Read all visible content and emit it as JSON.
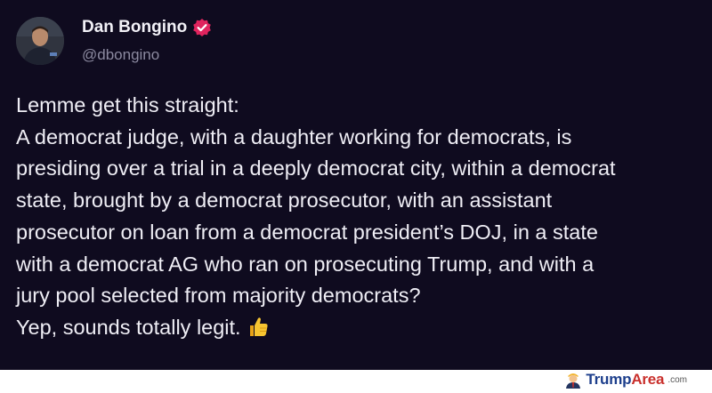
{
  "post": {
    "author_name": "Dan Bongino",
    "author_handle": "@dbongino",
    "body_lines": [
      "Lemme get this straight:",
      "A democrat judge, with a daughter working for democrats, is",
      "presiding over a trial in a deeply democrat city, within a democrat",
      "state, brought by a democrat prosecutor, with an assistant",
      "prosecutor on loan from a democrat president’s DOJ, in a state",
      "with a democrat AG who ran on prosecuting Trump, and with a",
      "jury pool selected from majority democrats?",
      "Yep, sounds totally legit."
    ],
    "trailing_emoji": "thumbs-up-icon",
    "verified_badge_color": "#e0245e"
  },
  "colors": {
    "card_background": "#0f0b1f",
    "text": "#efeef5",
    "handle": "#8c8aa0"
  },
  "watermark": {
    "brand_first": "Trump",
    "brand_second": "Area",
    "brand_suffix": ".com"
  }
}
